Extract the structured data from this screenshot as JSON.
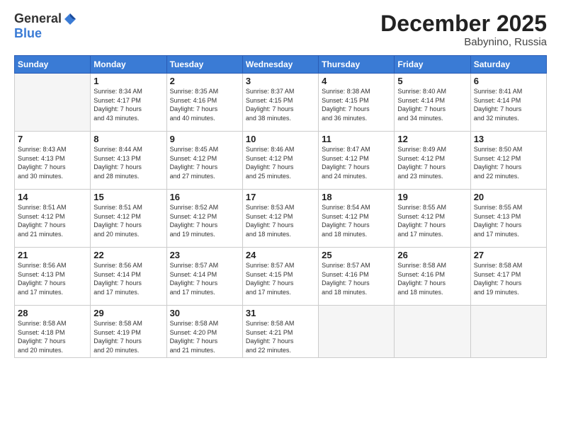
{
  "logo": {
    "general": "General",
    "blue": "Blue"
  },
  "title": {
    "month_year": "December 2025",
    "location": "Babynino, Russia"
  },
  "days_of_week": [
    "Sunday",
    "Monday",
    "Tuesday",
    "Wednesday",
    "Thursday",
    "Friday",
    "Saturday"
  ],
  "weeks": [
    [
      {
        "day": "",
        "info": ""
      },
      {
        "day": "1",
        "info": "Sunrise: 8:34 AM\nSunset: 4:17 PM\nDaylight: 7 hours\nand 43 minutes."
      },
      {
        "day": "2",
        "info": "Sunrise: 8:35 AM\nSunset: 4:16 PM\nDaylight: 7 hours\nand 40 minutes."
      },
      {
        "day": "3",
        "info": "Sunrise: 8:37 AM\nSunset: 4:15 PM\nDaylight: 7 hours\nand 38 minutes."
      },
      {
        "day": "4",
        "info": "Sunrise: 8:38 AM\nSunset: 4:15 PM\nDaylight: 7 hours\nand 36 minutes."
      },
      {
        "day": "5",
        "info": "Sunrise: 8:40 AM\nSunset: 4:14 PM\nDaylight: 7 hours\nand 34 minutes."
      },
      {
        "day": "6",
        "info": "Sunrise: 8:41 AM\nSunset: 4:14 PM\nDaylight: 7 hours\nand 32 minutes."
      }
    ],
    [
      {
        "day": "7",
        "info": "Sunrise: 8:43 AM\nSunset: 4:13 PM\nDaylight: 7 hours\nand 30 minutes."
      },
      {
        "day": "8",
        "info": "Sunrise: 8:44 AM\nSunset: 4:13 PM\nDaylight: 7 hours\nand 28 minutes."
      },
      {
        "day": "9",
        "info": "Sunrise: 8:45 AM\nSunset: 4:12 PM\nDaylight: 7 hours\nand 27 minutes."
      },
      {
        "day": "10",
        "info": "Sunrise: 8:46 AM\nSunset: 4:12 PM\nDaylight: 7 hours\nand 25 minutes."
      },
      {
        "day": "11",
        "info": "Sunrise: 8:47 AM\nSunset: 4:12 PM\nDaylight: 7 hours\nand 24 minutes."
      },
      {
        "day": "12",
        "info": "Sunrise: 8:49 AM\nSunset: 4:12 PM\nDaylight: 7 hours\nand 23 minutes."
      },
      {
        "day": "13",
        "info": "Sunrise: 8:50 AM\nSunset: 4:12 PM\nDaylight: 7 hours\nand 22 minutes."
      }
    ],
    [
      {
        "day": "14",
        "info": "Sunrise: 8:51 AM\nSunset: 4:12 PM\nDaylight: 7 hours\nand 21 minutes."
      },
      {
        "day": "15",
        "info": "Sunrise: 8:51 AM\nSunset: 4:12 PM\nDaylight: 7 hours\nand 20 minutes."
      },
      {
        "day": "16",
        "info": "Sunrise: 8:52 AM\nSunset: 4:12 PM\nDaylight: 7 hours\nand 19 minutes."
      },
      {
        "day": "17",
        "info": "Sunrise: 8:53 AM\nSunset: 4:12 PM\nDaylight: 7 hours\nand 18 minutes."
      },
      {
        "day": "18",
        "info": "Sunrise: 8:54 AM\nSunset: 4:12 PM\nDaylight: 7 hours\nand 18 minutes."
      },
      {
        "day": "19",
        "info": "Sunrise: 8:55 AM\nSunset: 4:12 PM\nDaylight: 7 hours\nand 17 minutes."
      },
      {
        "day": "20",
        "info": "Sunrise: 8:55 AM\nSunset: 4:13 PM\nDaylight: 7 hours\nand 17 minutes."
      }
    ],
    [
      {
        "day": "21",
        "info": "Sunrise: 8:56 AM\nSunset: 4:13 PM\nDaylight: 7 hours\nand 17 minutes."
      },
      {
        "day": "22",
        "info": "Sunrise: 8:56 AM\nSunset: 4:14 PM\nDaylight: 7 hours\nand 17 minutes."
      },
      {
        "day": "23",
        "info": "Sunrise: 8:57 AM\nSunset: 4:14 PM\nDaylight: 7 hours\nand 17 minutes."
      },
      {
        "day": "24",
        "info": "Sunrise: 8:57 AM\nSunset: 4:15 PM\nDaylight: 7 hours\nand 17 minutes."
      },
      {
        "day": "25",
        "info": "Sunrise: 8:57 AM\nSunset: 4:16 PM\nDaylight: 7 hours\nand 18 minutes."
      },
      {
        "day": "26",
        "info": "Sunrise: 8:58 AM\nSunset: 4:16 PM\nDaylight: 7 hours\nand 18 minutes."
      },
      {
        "day": "27",
        "info": "Sunrise: 8:58 AM\nSunset: 4:17 PM\nDaylight: 7 hours\nand 19 minutes."
      }
    ],
    [
      {
        "day": "28",
        "info": "Sunrise: 8:58 AM\nSunset: 4:18 PM\nDaylight: 7 hours\nand 20 minutes."
      },
      {
        "day": "29",
        "info": "Sunrise: 8:58 AM\nSunset: 4:19 PM\nDaylight: 7 hours\nand 20 minutes."
      },
      {
        "day": "30",
        "info": "Sunrise: 8:58 AM\nSunset: 4:20 PM\nDaylight: 7 hours\nand 21 minutes."
      },
      {
        "day": "31",
        "info": "Sunrise: 8:58 AM\nSunset: 4:21 PM\nDaylight: 7 hours\nand 22 minutes."
      },
      {
        "day": "",
        "info": ""
      },
      {
        "day": "",
        "info": ""
      },
      {
        "day": "",
        "info": ""
      }
    ]
  ]
}
